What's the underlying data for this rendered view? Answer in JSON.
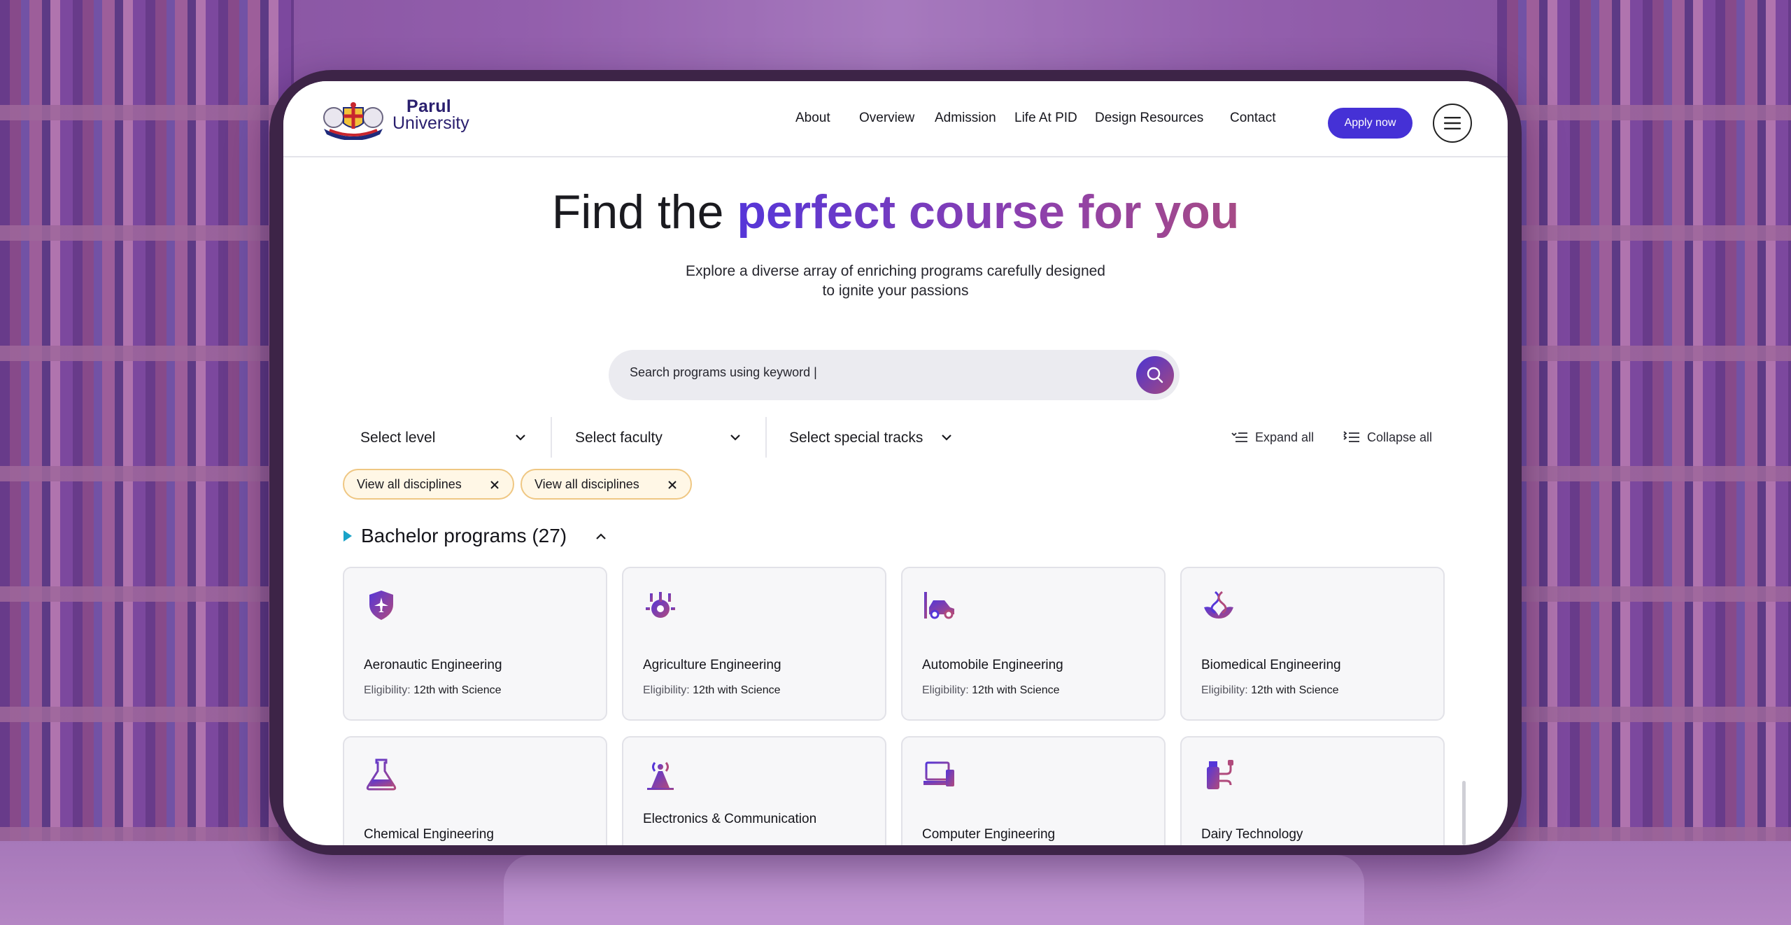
{
  "brand": {
    "name_line1": "Parul",
    "name_line2": "University",
    "primary_color": "#4531d6",
    "gradient_start": "#5536d8",
    "gradient_end": "#a64a86"
  },
  "nav": {
    "items": [
      {
        "label": "About"
      },
      {
        "label": "Overview"
      },
      {
        "label": "Admission"
      },
      {
        "label": "Life At PID"
      },
      {
        "label": "Design Resources"
      },
      {
        "label": "Contact"
      }
    ],
    "apply_label": "Apply now",
    "menu_icon": "hamburger-icon"
  },
  "hero": {
    "title_plain": "Find the ",
    "title_highlight": "perfect course for you",
    "subtitle": "Explore a diverse array of enriching programs carefully designed to ignite your passions"
  },
  "search": {
    "placeholder": "Search programs using keyword",
    "icon": "search-icon"
  },
  "filters": {
    "level": "Select level",
    "faculty": "Select faculty",
    "tracks": "Select special tracks",
    "expand_all": "Expand all",
    "collapse_all": "Collapse all"
  },
  "chips": [
    {
      "label": "View all disciplines"
    },
    {
      "label": "View all disciplines"
    }
  ],
  "section": {
    "title": "Bachelor programs (27)"
  },
  "eligibility_label": "Eligibility:",
  "programs": [
    {
      "name": "Aeronautic Engineering",
      "eligibility": "12th with Science",
      "icon": "shield-plane-icon"
    },
    {
      "name": "Agriculture Engineering",
      "eligibility": "12th with Science",
      "icon": "gear-wheat-icon"
    },
    {
      "name": "Automobile Engineering",
      "eligibility": "12th with Science",
      "icon": "car-lift-icon"
    },
    {
      "name": "Biomedical Engineering",
      "eligibility": "12th with Science",
      "icon": "dna-hand-icon"
    },
    {
      "name": "Chemical Engineering",
      "eligibility": "",
      "icon": "flask-icon"
    },
    {
      "name": "Electronics & Communication",
      "eligibility": "",
      "icon": "antenna-icon"
    },
    {
      "name": "Computer Engineering",
      "eligibility": "",
      "icon": "computer-icon"
    },
    {
      "name": "Dairy Technology",
      "eligibility": "",
      "icon": "milk-bottle-icon"
    }
  ]
}
